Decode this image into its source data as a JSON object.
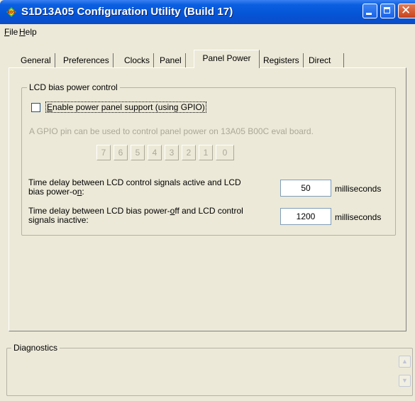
{
  "window": {
    "title": "S1D13A05 Configuration Utility  (Build 17)"
  },
  "menu": [
    {
      "label": "File",
      "accel": "F",
      "rest": "ile"
    },
    {
      "label": "Help",
      "accel": "H",
      "rest": "elp"
    }
  ],
  "tabs": [
    {
      "label": "General",
      "active": false
    },
    {
      "label": "Preferences",
      "active": false
    },
    {
      "label": "Clocks",
      "active": false
    },
    {
      "label": "Panel",
      "active": false
    },
    {
      "label": "Panel Power",
      "active": true
    },
    {
      "label": "Registers",
      "active": false
    },
    {
      "label": "Direct",
      "active": false
    }
  ],
  "lcd_group": {
    "legend": "LCD bias power control",
    "enable_checkbox": {
      "label": "Enable power panel support (using GPIO)",
      "accel": "E",
      "rest": "nable power panel support (using GPIO)",
      "checked": false
    },
    "gpio_hint": "A GPIO pin can be used to control panel power on 13A05 B00C eval board.",
    "gpio_pins": [
      "7",
      "6",
      "5",
      "4",
      "3",
      "2",
      "1",
      "0"
    ],
    "power_on_delay": {
      "label_line1": "Time delay between LCD control signals active and LCD",
      "label_line2_pre": "bias power-o",
      "label_line2_accel": "n",
      "label_line2_post": ":",
      "value": "50",
      "unit": "milliseconds"
    },
    "power_off_delay": {
      "label_line1_pre": "Time delay between LCD bias power-",
      "label_line1_accel": "o",
      "label_line1_post": "ff and LCD control",
      "label_line2": "signals inactive:",
      "value": "1200",
      "unit": "milliseconds"
    }
  },
  "diagnostics": {
    "legend": "Diagnostics"
  },
  "colors": {
    "titlebar": "#0554d6",
    "window_bg": "#ece9d8",
    "disabled_text": "#aca899"
  }
}
